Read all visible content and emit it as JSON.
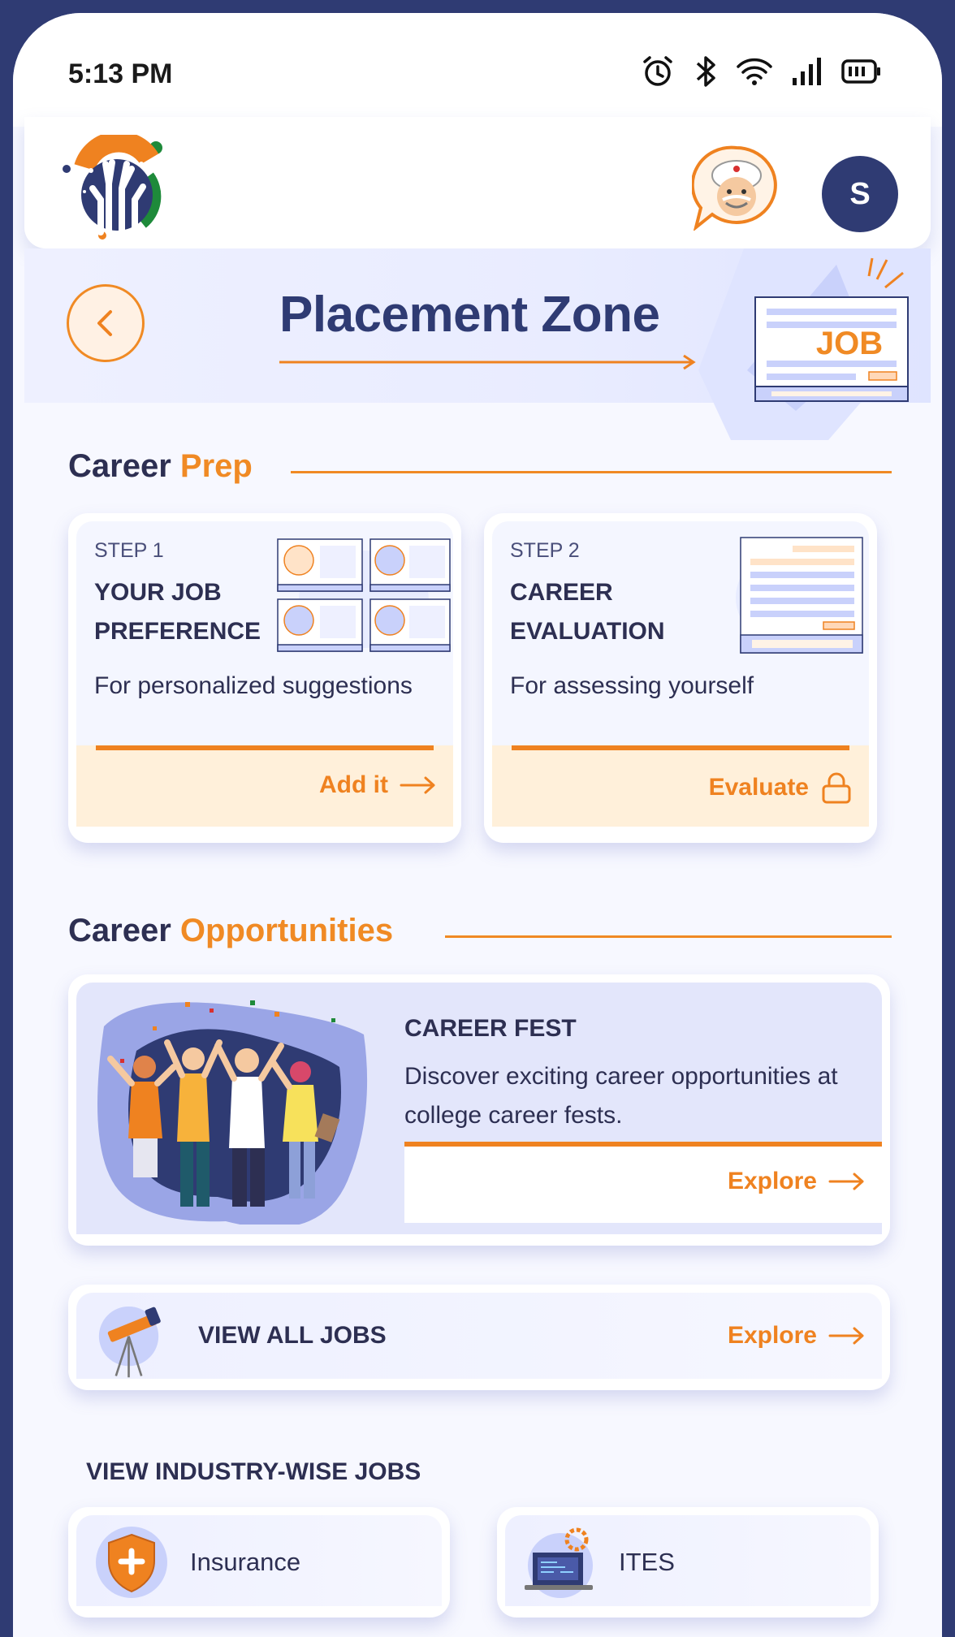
{
  "status_bar": {
    "time": "5:13 PM"
  },
  "header": {
    "avatar_initial": "S"
  },
  "page": {
    "title": "Placement Zone",
    "illustration_label": "JOB"
  },
  "career_prep": {
    "heading_main": "Career",
    "heading_accent": "Prep",
    "steps": [
      {
        "step": "STEP 1",
        "title": "YOUR JOB PREFERENCE",
        "desc": "For personalized suggestions",
        "action": "Add it"
      },
      {
        "step": "STEP 2",
        "title": "CAREER EVALUATION",
        "desc": "For assessing yourself",
        "action": "Evaluate"
      }
    ]
  },
  "career_opportunities": {
    "heading_main": "Career",
    "heading_accent": "Opportunities",
    "fest": {
      "title": "CAREER FEST",
      "desc": "Discover exciting career opportunities at college career fests.",
      "action": "Explore"
    },
    "all_jobs": {
      "title": "VIEW ALL JOBS",
      "action": "Explore"
    }
  },
  "industry": {
    "heading": "VIEW INDUSTRY-WISE JOBS",
    "items": [
      {
        "label": "Insurance"
      },
      {
        "label": "ITES"
      }
    ]
  },
  "colors": {
    "accent": "#ef8220",
    "navy": "#2f3b73",
    "text": "#2d2f52"
  }
}
